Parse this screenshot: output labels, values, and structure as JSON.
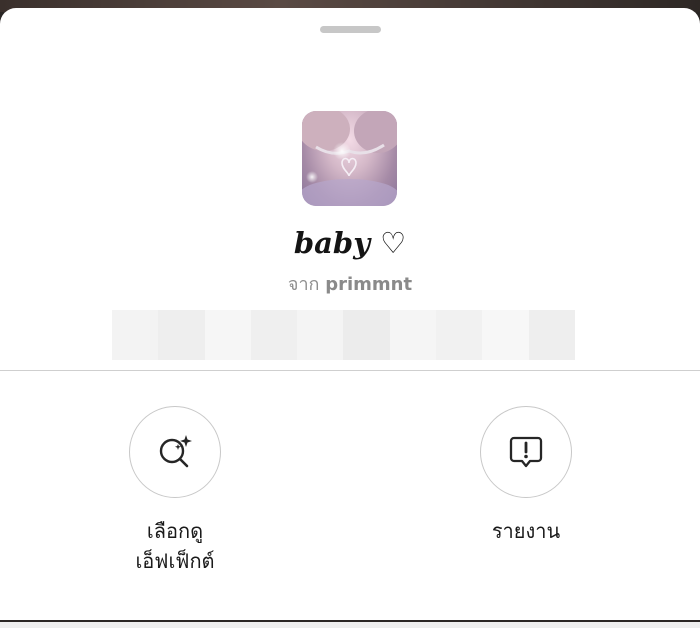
{
  "sheet": {
    "effect": {
      "name": "baby ♡",
      "by_prefix": "จาก",
      "author": "primmnt"
    },
    "actions": [
      {
        "label_line1": "เลือกดู",
        "label_line2": "เอ็ฟเฟ็กต์",
        "icon": "browse-effects-icon"
      },
      {
        "label_line1": "รายงาน",
        "icon": "report-icon"
      }
    ]
  },
  "colors": {
    "sheet_background": "#ffffff",
    "primary_text": "#141414",
    "secondary_text": "#8e8e8e",
    "divider": "#cfcfcf"
  }
}
